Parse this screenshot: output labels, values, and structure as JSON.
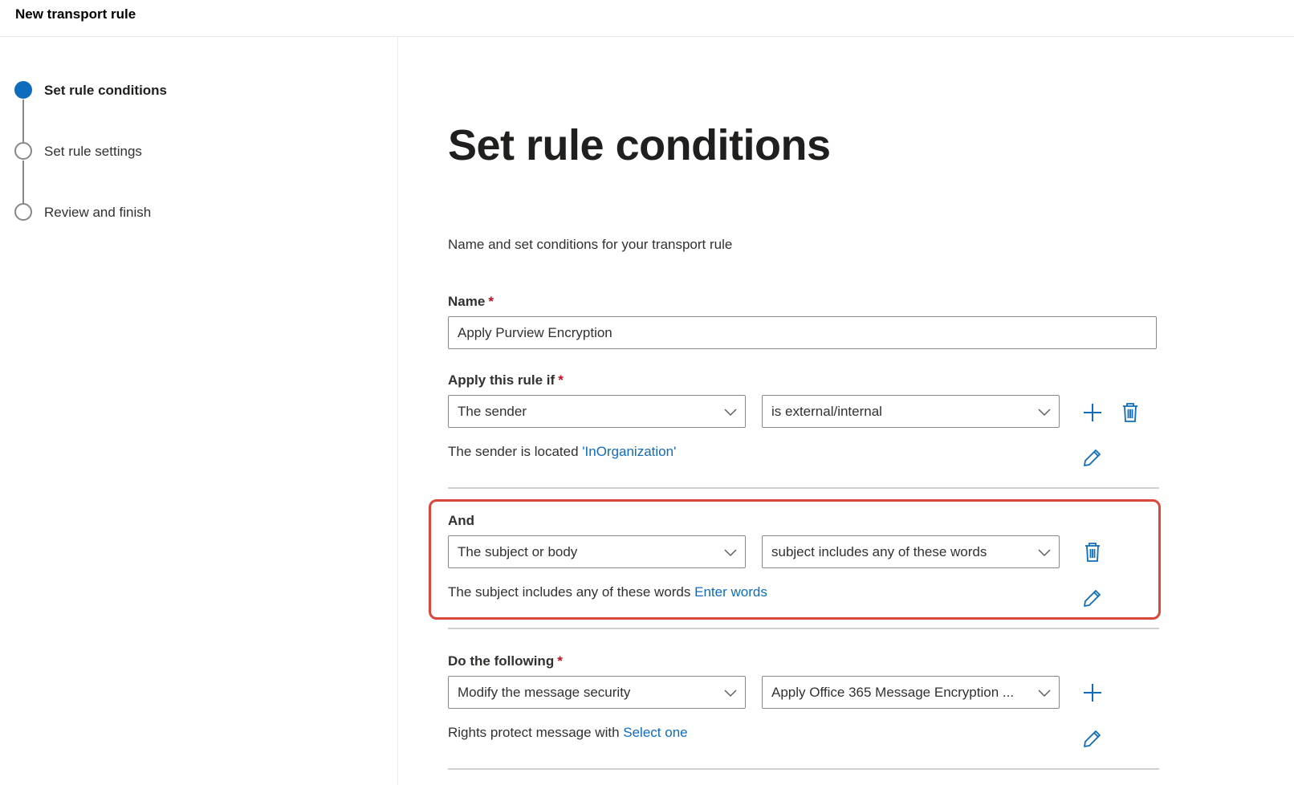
{
  "header": {
    "title": "New transport rule"
  },
  "steps": [
    {
      "label": "Set rule conditions",
      "state": "current"
    },
    {
      "label": "Set rule settings",
      "state": "pending"
    },
    {
      "label": "Review and finish",
      "state": "pending"
    }
  ],
  "main": {
    "title": "Set rule conditions",
    "description": "Name and set conditions for your transport rule",
    "name_field": {
      "label": "Name",
      "required_mark": "*",
      "value": "Apply Purview Encryption"
    },
    "condition": {
      "label": "Apply this rule if",
      "required_mark": "*",
      "select1": "The sender",
      "select2": "is external/internal",
      "summary_prefix": "The sender is located ",
      "summary_link": "'InOrganization'"
    },
    "and_condition": {
      "label": "And",
      "select1": "The subject or body",
      "select2": "subject includes any of these words",
      "summary_prefix": "The subject includes any of these words ",
      "summary_link": "Enter words"
    },
    "action": {
      "label": "Do the following",
      "required_mark": "*",
      "select1": "Modify the message security",
      "select2": "Apply Office 365 Message Encryption ...",
      "summary_prefix": "Rights protect message with ",
      "summary_link": "Select one"
    }
  },
  "colors": {
    "accent": "#0f6cbd",
    "required": "#c50f1f",
    "highlight_border": "#d9483b"
  },
  "icons": [
    "plus-icon",
    "trash-icon",
    "pencil-icon",
    "chevron-down-icon"
  ]
}
